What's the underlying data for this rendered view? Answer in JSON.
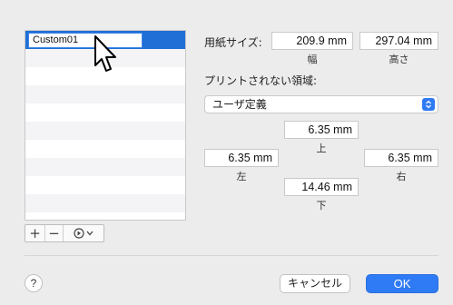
{
  "list": {
    "selected_name": "Custom01"
  },
  "toolbar": {
    "add_label": "+",
    "remove_label": "−",
    "action_label": "⊙ ⌄"
  },
  "paper": {
    "label": "用紙サイズ:",
    "width_value": "209.9 mm",
    "width_caption": "幅",
    "height_value": "297.04 mm",
    "height_caption": "高さ"
  },
  "nonprint": {
    "label": "プリントされない領域:",
    "select_value": "ユーザ定義",
    "top_value": "6.35 mm",
    "top_caption": "上",
    "left_value": "6.35 mm",
    "left_caption": "左",
    "right_value": "6.35 mm",
    "right_caption": "右",
    "bottom_value": "14.46 mm",
    "bottom_caption": "下"
  },
  "footer": {
    "help_label": "?",
    "cancel_label": "キャンセル",
    "ok_label": "OK"
  },
  "colors": {
    "accent": "#2f7bf5",
    "selection": "#1f6fd6",
    "background": "#ececec"
  }
}
